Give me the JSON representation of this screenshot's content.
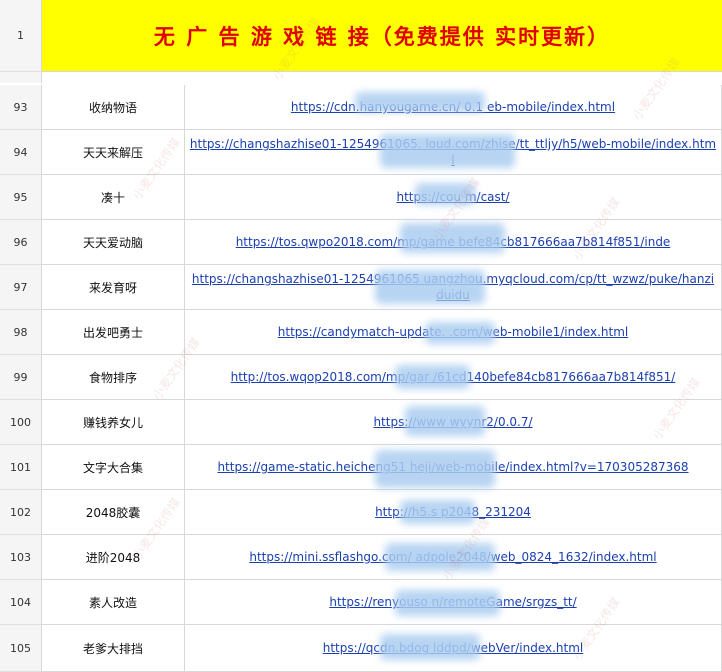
{
  "header": {
    "row_number": "1",
    "title": "无 广 告 游 戏 链 接（免费提供 实时更新）"
  },
  "rows": [
    {
      "num": "93",
      "name": "收纳物语",
      "url": "https://cdn.hanyougame.cn/ 0.1 eb-mobile/index.html"
    },
    {
      "num": "94",
      "name": "天天来解压",
      "url": "https://changshazhise01-1254961065. loud.com/zhise/tt_ttljy/h5/web-mobile/index.html"
    },
    {
      "num": "95",
      "name": "凑十",
      "url": "https://cou m/cast/"
    },
    {
      "num": "96",
      "name": "天天爱动脑",
      "url": "https://tos.qwpo2018.com/mp/game befe84cb817666aa7b814f851/inde"
    },
    {
      "num": "97",
      "name": "来发育呀",
      "url": "https://changshazhise01-1254961065 uangzhou.myqcloud.com/cp/tt_wzwz/puke/hanziduidu"
    },
    {
      "num": "98",
      "name": "出发吧勇士",
      "url": "https://candymatch-update. .com/web-mobile1/index.html"
    },
    {
      "num": "99",
      "name": "食物排序",
      "url": "http://tos.wqop2018.com/mp/gar /61cd140befe84cb817666aa7b814f851/"
    },
    {
      "num": "100",
      "name": "赚钱养女儿",
      "url": "https://www wyynr2/0.0.7/"
    },
    {
      "num": "101",
      "name": "文字大合集",
      "url": "https://game-static.heicheng51 heji/web-mobile/index.html?v=170305287368"
    },
    {
      "num": "102",
      "name": "2048胶囊",
      "url": "http://h5.s p2048_231204"
    },
    {
      "num": "103",
      "name": "进阶2048",
      "url": "https://mini.ssflashgo.com/ adpole2048/web_0824_1632/index.html"
    },
    {
      "num": "104",
      "name": "素人改造",
      "url": "https://renyouso n/remoteGame/srgzs_tt/"
    },
    {
      "num": "105",
      "name": "老爹大排挡",
      "url": "https://qcdn.bdog lddpd/webVer/index.html"
    }
  ],
  "watermark": "小麦文化传媒"
}
